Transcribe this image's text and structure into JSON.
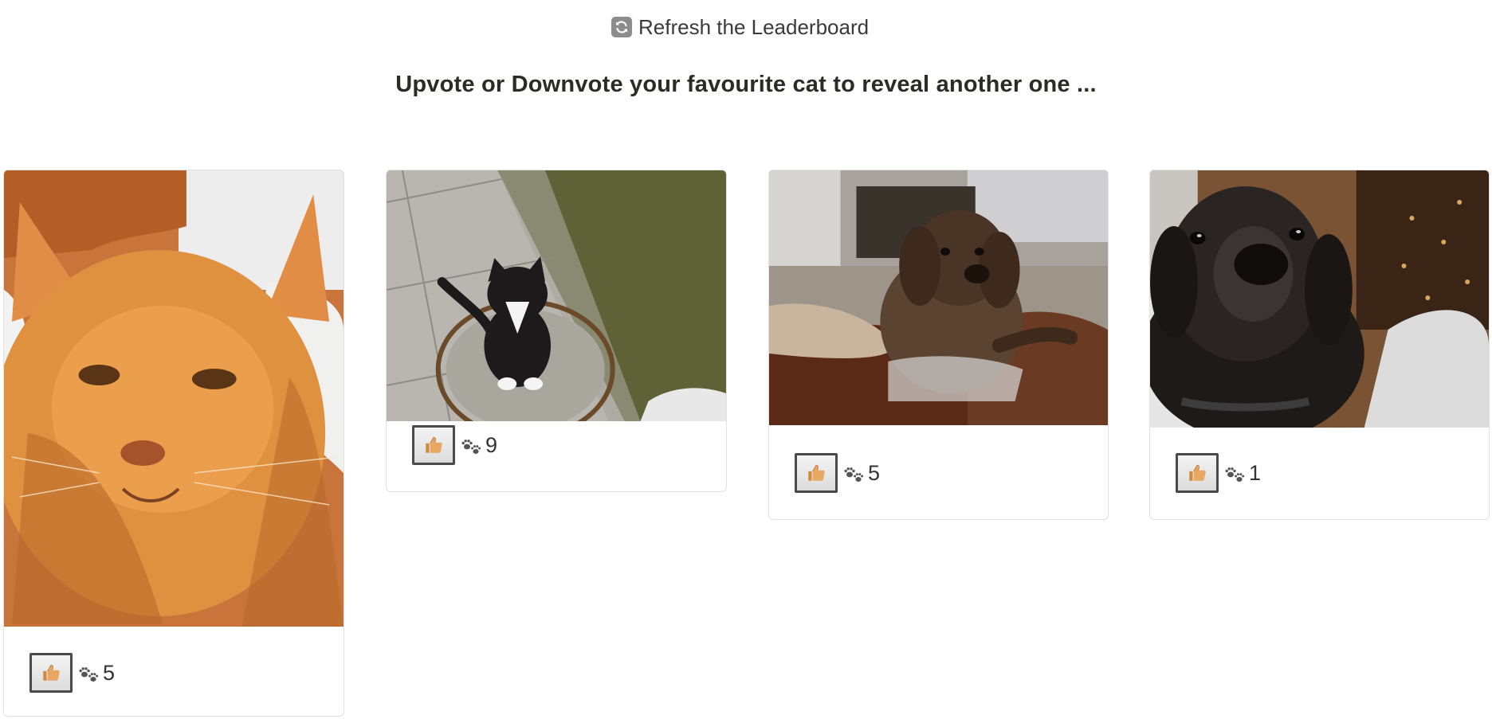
{
  "header": {
    "refresh_label": "Refresh the Leaderboard",
    "refresh_icon": "refresh-icon",
    "heading": "Upvote or Downvote your favourite cat to reveal another one ..."
  },
  "cards": [
    {
      "subject": "ginger cat",
      "upvote_icon": "thumbs-up-icon",
      "votes": "5"
    },
    {
      "subject": "black and white cat on a manhole cover",
      "upvote_icon": "thumbs-up-icon",
      "votes": "9"
    },
    {
      "subject": "shaggy brown dog on a sofa",
      "upvote_icon": "thumbs-up-icon",
      "votes": "5"
    },
    {
      "subject": "black labrador",
      "upvote_icon": "thumbs-up-icon",
      "votes": "1"
    }
  ],
  "colors": {
    "heading": "#2e2a24",
    "card_border": "#e2e2e2",
    "button_border": "#4a4a4a",
    "thumb": "#e3a35c"
  }
}
